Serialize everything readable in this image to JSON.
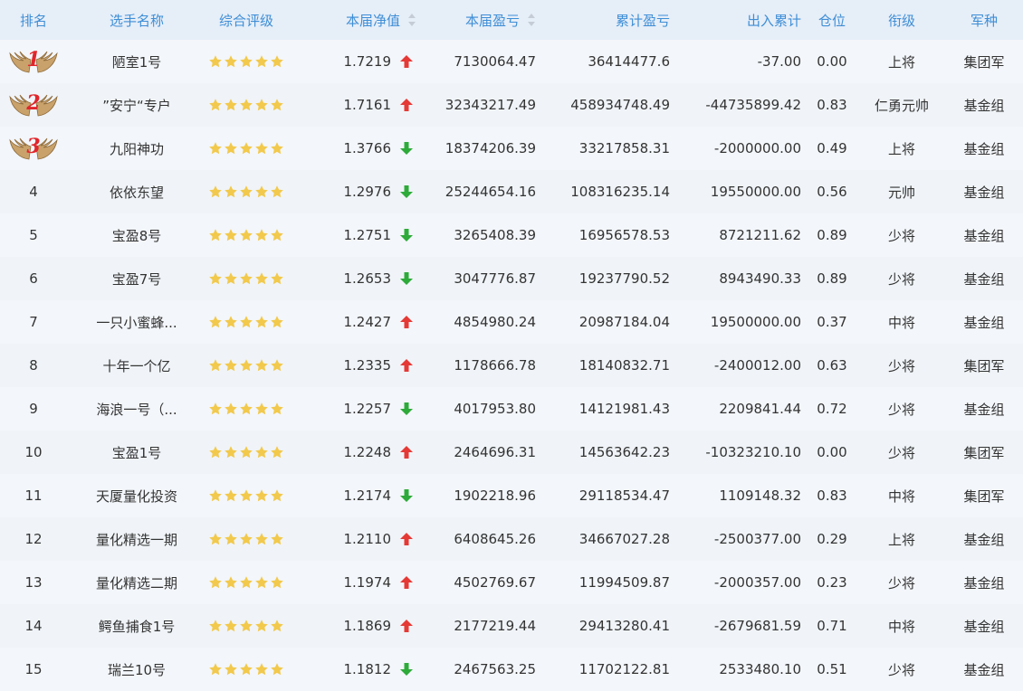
{
  "header": {
    "rank": "排名",
    "name": "选手名称",
    "rating": "综合评级",
    "nav": "本届净值",
    "pnl": "本届盈亏",
    "cum": "累计盈亏",
    "io": "出入累计",
    "pos": "仓位",
    "grade": "衔级",
    "army": "军种"
  },
  "colors": {
    "header_text": "#3e8ed6",
    "up_arrow": "#e53935",
    "down_arrow": "#2eaa3a",
    "star": "#f2c94c",
    "medal_number": "#e0262b"
  },
  "rows": [
    {
      "rank": "1",
      "medal": true,
      "name": "陋室1号",
      "stars": 5,
      "nav": "1.7219",
      "dir": "up",
      "pnl": "7130064.47",
      "cum": "36414477.6",
      "io": "-37.00",
      "pos": "0.00",
      "grade": "上将",
      "army": "集团军"
    },
    {
      "rank": "2",
      "medal": true,
      "name": "”安宁“专户",
      "stars": 5,
      "nav": "1.7161",
      "dir": "up",
      "pnl": "32343217.49",
      "cum": "458934748.49",
      "io": "-44735899.42",
      "pos": "0.83",
      "grade": "仁勇元帅",
      "army": "基金组"
    },
    {
      "rank": "3",
      "medal": true,
      "name": "九阳神功",
      "stars": 5,
      "nav": "1.3766",
      "dir": "down",
      "pnl": "18374206.39",
      "cum": "33217858.31",
      "io": "-2000000.00",
      "pos": "0.49",
      "grade": "上将",
      "army": "基金组"
    },
    {
      "rank": "4",
      "medal": false,
      "name": "依依东望",
      "stars": 5,
      "nav": "1.2976",
      "dir": "down",
      "pnl": "25244654.16",
      "cum": "108316235.14",
      "io": "19550000.00",
      "pos": "0.56",
      "grade": "元帅",
      "army": "基金组"
    },
    {
      "rank": "5",
      "medal": false,
      "name": "宝盈8号",
      "stars": 5,
      "nav": "1.2751",
      "dir": "down",
      "pnl": "3265408.39",
      "cum": "16956578.53",
      "io": "8721211.62",
      "pos": "0.89",
      "grade": "少将",
      "army": "基金组"
    },
    {
      "rank": "6",
      "medal": false,
      "name": "宝盈7号",
      "stars": 5,
      "nav": "1.2653",
      "dir": "down",
      "pnl": "3047776.87",
      "cum": "19237790.52",
      "io": "8943490.33",
      "pos": "0.89",
      "grade": "少将",
      "army": "基金组"
    },
    {
      "rank": "7",
      "medal": false,
      "name": "一只小蜜蜂...",
      "stars": 5,
      "nav": "1.2427",
      "dir": "up",
      "pnl": "4854980.24",
      "cum": "20987184.04",
      "io": "19500000.00",
      "pos": "0.37",
      "grade": "中将",
      "army": "基金组"
    },
    {
      "rank": "8",
      "medal": false,
      "name": "十年一个亿",
      "stars": 5,
      "nav": "1.2335",
      "dir": "up",
      "pnl": "1178666.78",
      "cum": "18140832.71",
      "io": "-2400012.00",
      "pos": "0.63",
      "grade": "少将",
      "army": "集团军"
    },
    {
      "rank": "9",
      "medal": false,
      "name": "海浪一号（...",
      "stars": 5,
      "nav": "1.2257",
      "dir": "down",
      "pnl": "4017953.80",
      "cum": "14121981.43",
      "io": "2209841.44",
      "pos": "0.72",
      "grade": "少将",
      "army": "基金组"
    },
    {
      "rank": "10",
      "medal": false,
      "name": "宝盈1号",
      "stars": 5,
      "nav": "1.2248",
      "dir": "up",
      "pnl": "2464696.31",
      "cum": "14563642.23",
      "io": "-10323210.10",
      "pos": "0.00",
      "grade": "少将",
      "army": "集团军"
    },
    {
      "rank": "11",
      "medal": false,
      "name": "天厦量化投资",
      "stars": 5,
      "nav": "1.2174",
      "dir": "down",
      "pnl": "1902218.96",
      "cum": "29118534.47",
      "io": "1109148.32",
      "pos": "0.83",
      "grade": "中将",
      "army": "集团军"
    },
    {
      "rank": "12",
      "medal": false,
      "name": "量化精选一期",
      "stars": 5,
      "nav": "1.2110",
      "dir": "up",
      "pnl": "6408645.26",
      "cum": "34667027.28",
      "io": "-2500377.00",
      "pos": "0.29",
      "grade": "上将",
      "army": "基金组"
    },
    {
      "rank": "13",
      "medal": false,
      "name": "量化精选二期",
      "stars": 5,
      "nav": "1.1974",
      "dir": "up",
      "pnl": "4502769.67",
      "cum": "11994509.87",
      "io": "-2000357.00",
      "pos": "0.23",
      "grade": "少将",
      "army": "基金组"
    },
    {
      "rank": "14",
      "medal": false,
      "name": "鳄鱼捕食1号",
      "stars": 5,
      "nav": "1.1869",
      "dir": "up",
      "pnl": "2177219.44",
      "cum": "29413280.41",
      "io": "-2679681.59",
      "pos": "0.71",
      "grade": "中将",
      "army": "基金组"
    },
    {
      "rank": "15",
      "medal": false,
      "name": "瑞兰10号",
      "stars": 5,
      "nav": "1.1812",
      "dir": "down",
      "pnl": "2467563.25",
      "cum": "11702122.81",
      "io": "2533480.10",
      "pos": "0.51",
      "grade": "少将",
      "army": "基金组"
    }
  ]
}
